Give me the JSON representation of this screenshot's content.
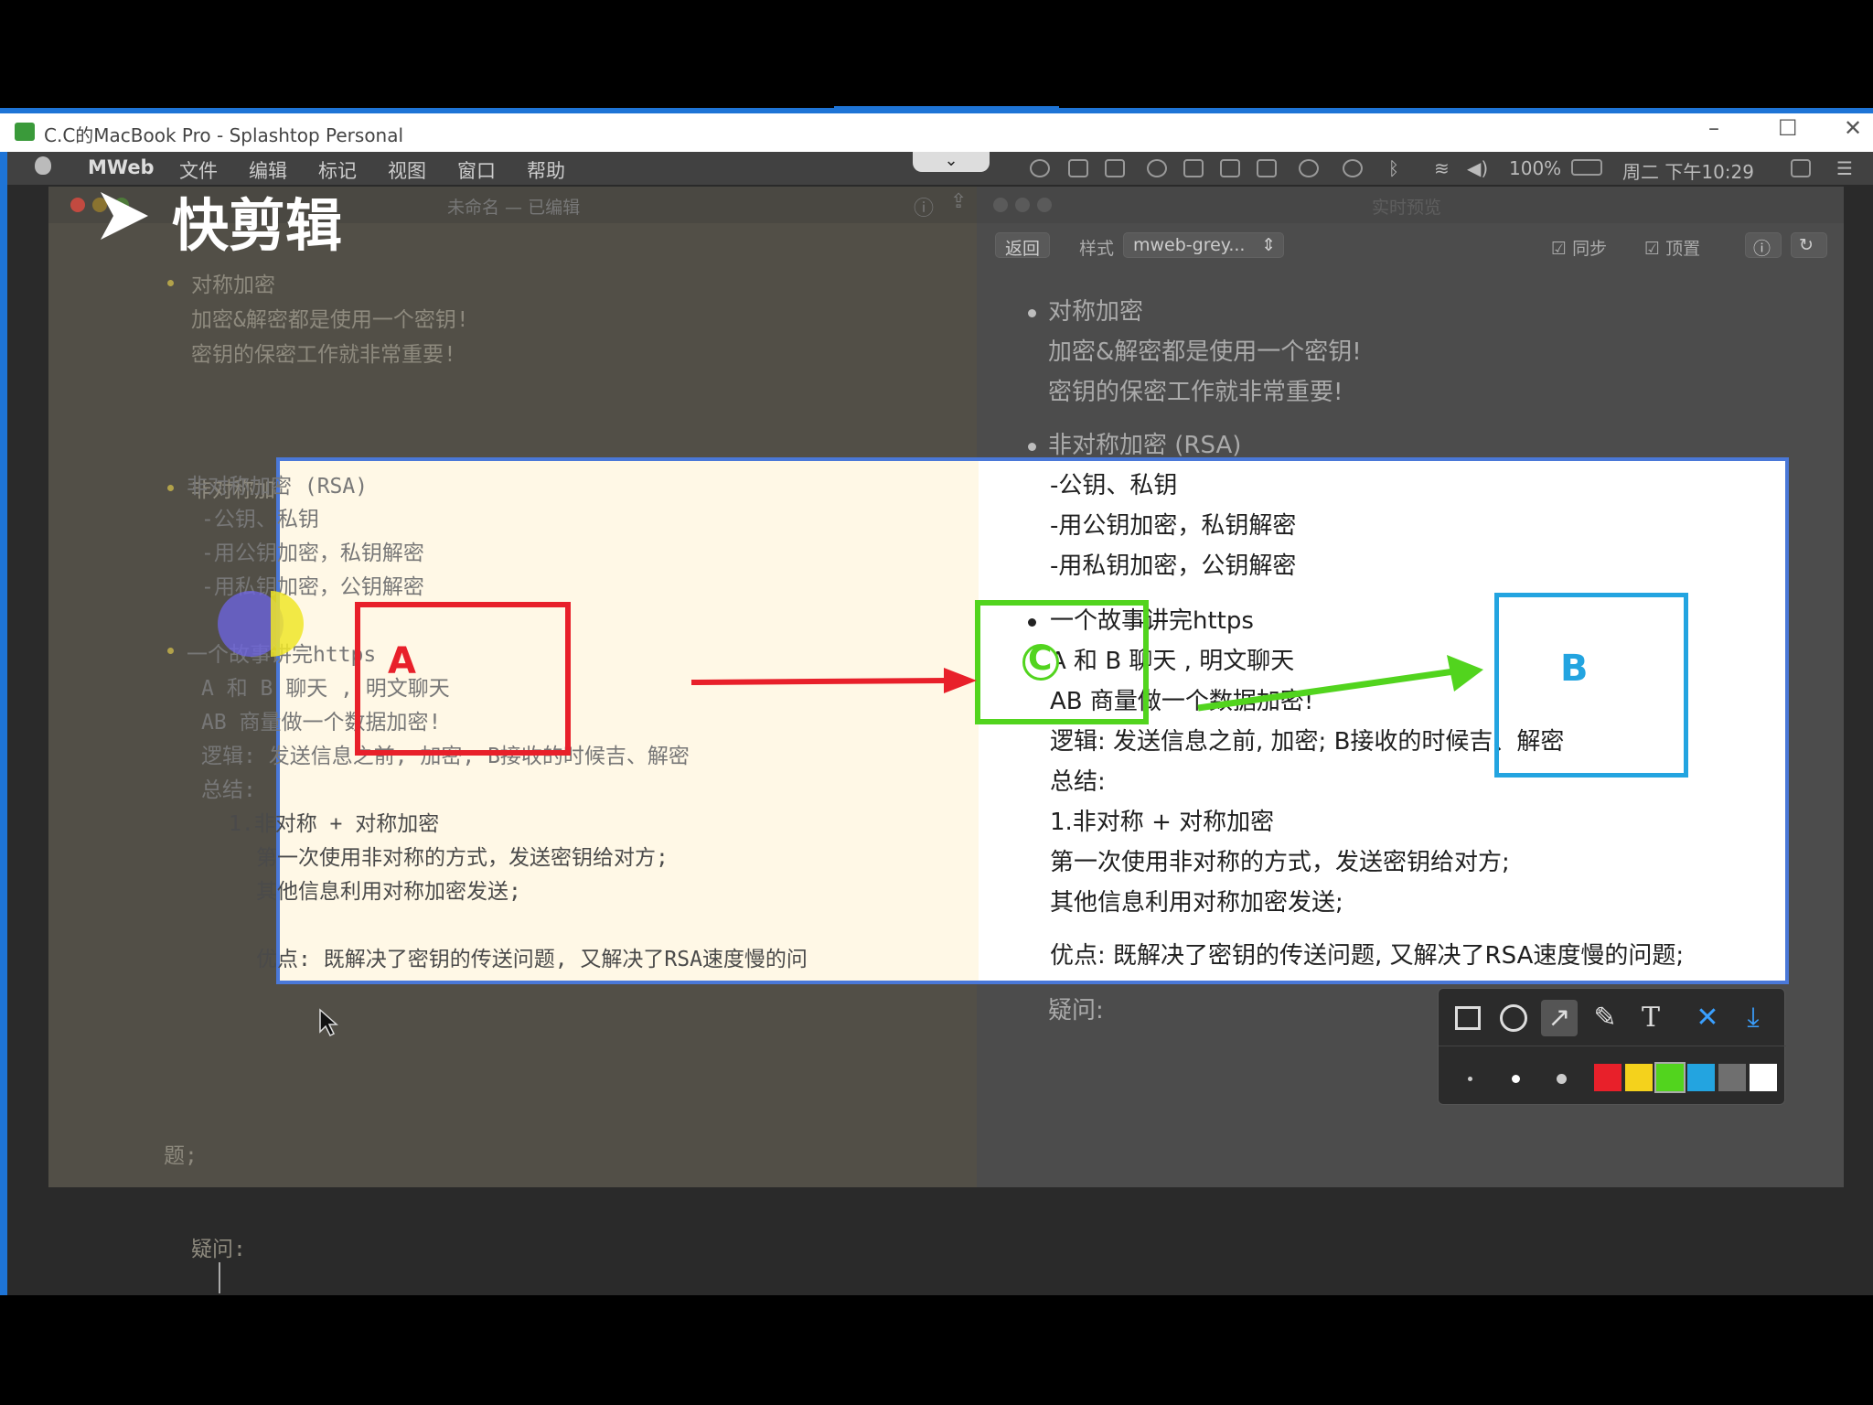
{
  "splashtop": {
    "title": "C.C的MacBook Pro - Splashtop Personal",
    "minimize": "–",
    "maximize": "☐",
    "close": "✕"
  },
  "menubar": {
    "app": "MWeb",
    "items": [
      "文件",
      "编辑",
      "标记",
      "视图",
      "窗口",
      "帮助"
    ],
    "battery": "100%",
    "clock": "周二 下午10:29"
  },
  "watermark": {
    "text": "快剪辑"
  },
  "editor": {
    "title": "未命名 — 已编辑",
    "lines": [
      "对称加密",
      "加密&解密都是使用一个密钥!",
      "密钥的保密工作就非常重要!",
      "非对称加密 (RSA)",
      "-公钥、私钥",
      "-用公钥加密，私钥解密",
      "-用私钥加密，公钥解密",
      "一个故事讲完https",
      "A 和 B 聊天 , 明文聊天",
      "AB 商量做一个数据加密!",
      "逻辑: 发送信息之前, 加密; B接收的时候吉、解密",
      "总结:",
      "1.非对称 + 对称加密",
      "第一次使用非对称的方式，发送密钥给对方;",
      "其他信息利用对称加密发送;",
      "优点: 既解决了密钥的传送问题, 又解决了RSA速度慢的问",
      "题;",
      "疑问:"
    ]
  },
  "preview": {
    "title": "实时预览",
    "back": "返回",
    "style_label": "样式",
    "style_value": "mweb-grey...",
    "sync": "同步",
    "pin": "顶置",
    "lines": [
      "对称加密",
      "加密&解密都是使用一个密钥!",
      "密钥的保密工作就非常重要!",
      "非对称加密 (RSA)",
      "-公钥、私钥",
      "-用公钥加密，私钥解密",
      "-用私钥加密，公钥解密",
      "一个故事讲完https",
      "A 和 B 聊天 , 明文聊天",
      "AB 商量做一个数据加密!",
      "逻辑: 发送信息之前, 加密; B接收的时候吉、解密",
      "总结:",
      "1.非对称 + 对称加密",
      "第一次使用非对称的方式，发送密钥给对方;",
      "其他信息利用对称加密发送;",
      "优点: 既解决了密钥的传送问题, 又解决了RSA速度慢的问题;",
      "疑问:"
    ]
  },
  "annotations": {
    "label_a": "A",
    "label_b": "B",
    "label_c": "C",
    "colors": {
      "red": "#e8202a",
      "green": "#52d41e",
      "blue": "#23a4e0",
      "overlay_border": "#4a78d8"
    }
  },
  "ann_toolbar": {
    "tools": [
      "rectangle-icon",
      "circle-icon",
      "arrow-icon",
      "brush-icon",
      "text-icon",
      "close-icon",
      "download-icon"
    ],
    "text_tool": "T",
    "close": "✕",
    "swatches": [
      "#e8202a",
      "#f4d21c",
      "#52d41e",
      "#23a4e0",
      "#6f6f6f",
      "#ffffff"
    ]
  }
}
